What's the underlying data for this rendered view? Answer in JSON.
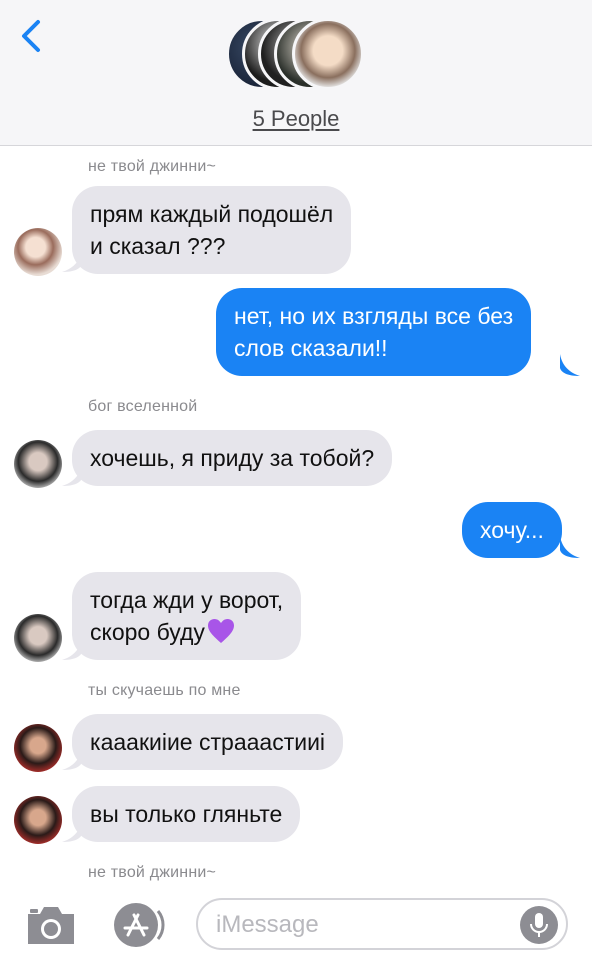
{
  "header": {
    "back_icon": "chevron-left-icon",
    "group_name": "5 People",
    "accent_color": "#1a83f4"
  },
  "messages": [
    {
      "sender": "не твой джинни~"
    },
    {
      "text_lines": [
        "прям каждый подошёл",
        "и сказал ???"
      ]
    },
    {
      "text_lines": [
        "нет, но их взгляды все без",
        "слов сказали!!"
      ]
    },
    {
      "sender": "бог вселенной"
    },
    {
      "text_lines": [
        "хочешь, я приду за тобой?"
      ]
    },
    {
      "text_lines": [
        "хочу..."
      ]
    },
    {
      "text_lines": [
        "тогда жди у ворот,",
        "скоро буду"
      ],
      "emoji": "purple-heart-icon"
    },
    {
      "sender": "ты скучаешь по мне"
    },
    {
      "text_lines": [
        "кааакиiие страаастииi"
      ]
    },
    {
      "text_lines": [
        "вы только гляньте"
      ]
    },
    {
      "sender": "не твой джинни~"
    }
  ],
  "compose": {
    "placeholder": "iMessage",
    "camera_icon": "camera-icon",
    "apps_icon": "app-store-icon",
    "mic_icon": "microphone-icon"
  },
  "colors": {
    "incoming_bubble": "#e6e5eb",
    "outgoing_bubble": "#1a83f4",
    "sender_label": "#8a8a8e"
  }
}
